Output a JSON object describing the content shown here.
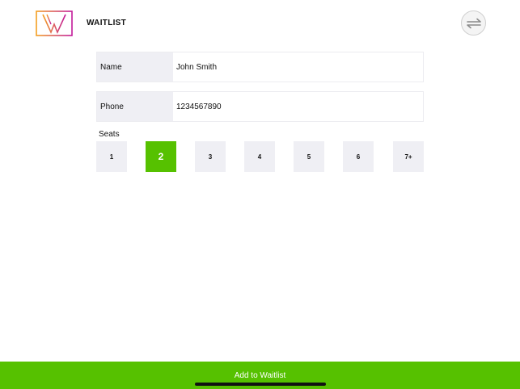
{
  "header": {
    "title": "WAITLIST",
    "logo_icon": "waitlist-logo",
    "switch_icon": "switch-arrows-icon"
  },
  "form": {
    "name": {
      "label": "Name",
      "value": "John Smith"
    },
    "phone": {
      "label": "Phone",
      "value": "1234567890"
    },
    "seats": {
      "label": "Seats",
      "options": [
        "1",
        "2",
        "3",
        "4",
        "5",
        "6",
        "7+"
      ],
      "selected": "2"
    }
  },
  "actions": {
    "add_label": "Add to Waitlist"
  },
  "colors": {
    "accent": "#56c100",
    "field_bg": "#efeff4",
    "logo_orange": "#f4a021",
    "logo_magenta": "#c2189a"
  }
}
